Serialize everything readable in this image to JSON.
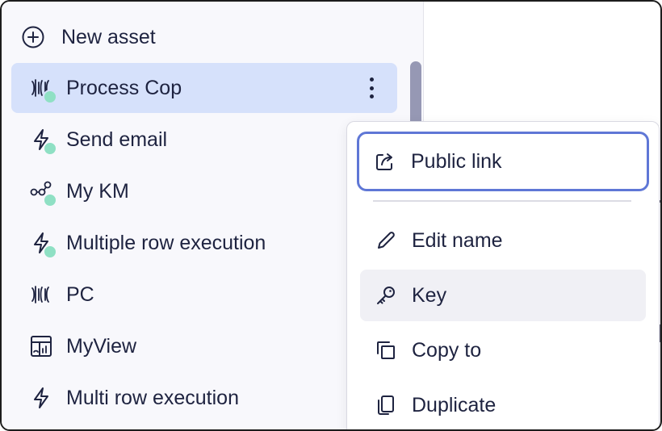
{
  "sidebar": {
    "new_asset_label": "New asset",
    "items": [
      {
        "label": "Process Cop",
        "icon": "process-icon",
        "status_dot": true,
        "active": true
      },
      {
        "label": "Send email",
        "icon": "lightning-icon",
        "status_dot": true,
        "active": false
      },
      {
        "label": "My KM",
        "icon": "knowledge-map-icon",
        "status_dot": true,
        "active": false
      },
      {
        "label": "Multiple row execution",
        "icon": "lightning-icon",
        "status_dot": true,
        "active": false
      },
      {
        "label": "PC",
        "icon": "process-icon",
        "status_dot": false,
        "active": false
      },
      {
        "label": "MyView",
        "icon": "view-icon",
        "status_dot": false,
        "active": false
      },
      {
        "label": "Multi row execution",
        "icon": "lightning-icon",
        "status_dot": false,
        "active": false
      }
    ]
  },
  "context_menu": {
    "items": [
      {
        "label": "Public link",
        "icon": "share-icon",
        "state": "focused"
      },
      {
        "label": "Edit name",
        "icon": "pencil-icon",
        "state": "normal"
      },
      {
        "label": "Key",
        "icon": "key-icon",
        "state": "hover"
      },
      {
        "label": "Copy to",
        "icon": "copy-icon",
        "state": "normal"
      },
      {
        "label": "Duplicate",
        "icon": "duplicate-icon",
        "state": "normal"
      }
    ]
  },
  "colors": {
    "active_row": "#d6e1fb",
    "status_dot": "#8fe0c4",
    "focus_ring": "#5f77d6",
    "hover_row": "#f0f0f5",
    "text": "#1e2340"
  }
}
